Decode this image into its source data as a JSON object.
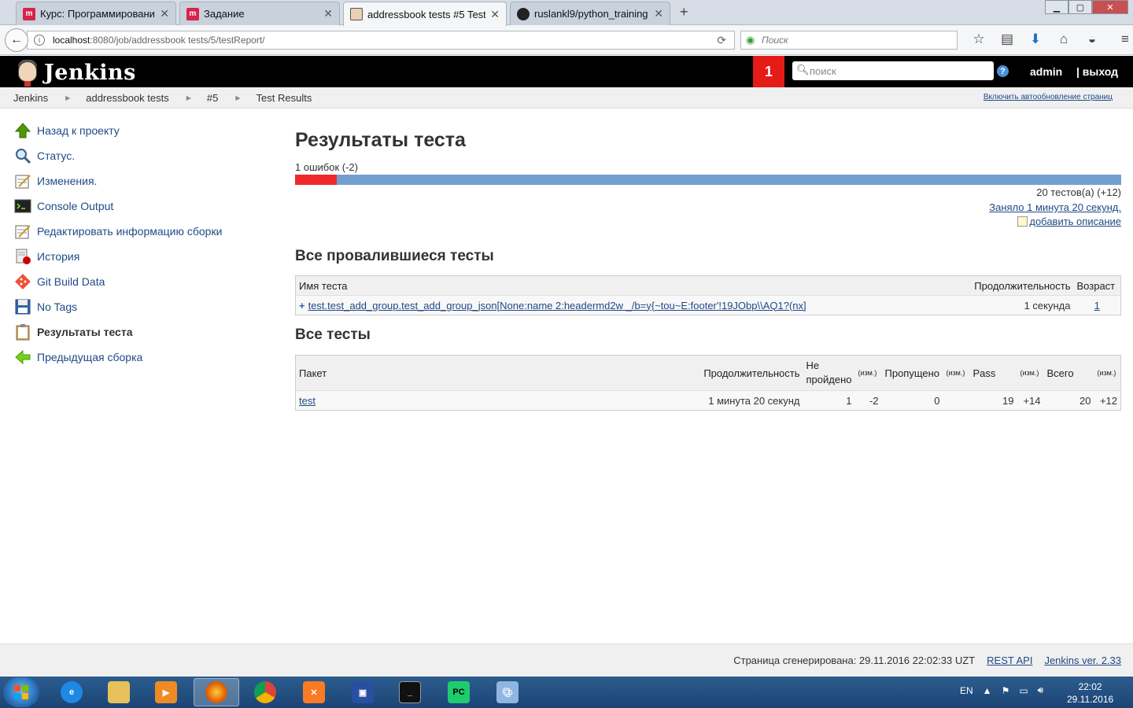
{
  "browser": {
    "tabs": [
      {
        "title": "Курс: Программировани...",
        "icon": "m-icon",
        "active": false
      },
      {
        "title": "Задание",
        "icon": "m-icon",
        "active": false
      },
      {
        "title": "addressbook tests #5 Test ...",
        "icon": "jenkins-icon",
        "active": true
      },
      {
        "title": "ruslankl9/python_training",
        "icon": "github-icon",
        "active": false
      }
    ],
    "url_host": "localhost",
    "url_path": ":8080/job/addressbook tests/5/testReport/",
    "search_placeholder": "Поиск"
  },
  "header": {
    "logo_text": "Jenkins",
    "badge_count": "1",
    "search_placeholder": "поиск",
    "help": "?",
    "user": "admin",
    "logout": "| выход"
  },
  "breadcrumb": {
    "items": [
      "Jenkins",
      "addressbook tests",
      "#5",
      "Test Results"
    ],
    "autorefresh": "Включить автообновление страниц"
  },
  "sidebar": {
    "items": [
      {
        "label": "Назад к проекту",
        "icon": "up-arrow-icon"
      },
      {
        "label": "Статус.",
        "icon": "magnifier-icon"
      },
      {
        "label": "Изменения.",
        "icon": "notepad-icon"
      },
      {
        "label": "Console Output",
        "icon": "terminal-icon"
      },
      {
        "label": "Редактировать информацию сборки",
        "icon": "notepad-icon"
      },
      {
        "label": "История",
        "icon": "history-icon"
      },
      {
        "label": "Git Build Data",
        "icon": "git-icon"
      },
      {
        "label": "No Tags",
        "icon": "floppy-icon"
      },
      {
        "label": "Результаты теста",
        "icon": "clipboard-icon"
      },
      {
        "label": "Предыдущая сборка",
        "icon": "left-arrow-icon"
      }
    ]
  },
  "main": {
    "title": "Результаты теста",
    "fail_summary": "1 ошибок (-2)",
    "fail_fraction": 0.05,
    "total_tests": "20 тестов(а) (+12)",
    "duration_link": "Заняло 1 минута 20 секунд.",
    "add_description": "добавить описание",
    "failed_section": {
      "heading": "Все провалившиеся тесты",
      "columns": [
        "Имя теста",
        "Продолжительность",
        "Возраст"
      ],
      "rows": [
        {
          "name": "test.test_add_group.test_add_group_json[None:name 2:headermd2w _/b=y{~tou~E:footer'!19JObp\\\\AQ1?(nx]",
          "duration": "1 секунда",
          "age": "1"
        }
      ]
    },
    "all_section": {
      "heading": "Все тесты",
      "columns": {
        "package": "Пакет",
        "duration": "Продолжительность",
        "failed": "Не пройдено",
        "diff": "(изм.)",
        "skipped": "Пропущено",
        "pass": "Pass",
        "total": "Всего"
      },
      "rows": [
        {
          "package": "test",
          "duration": "1 минута 20 секунд",
          "failed": "1",
          "failed_diff": "-2",
          "skipped": "0",
          "skipped_diff": "",
          "pass": "19",
          "pass_diff": "+14",
          "total": "20",
          "total_diff": "+12"
        }
      ]
    }
  },
  "footer": {
    "generated": "Страница сгенерирована: 29.11.2016 22:02:33 UZT",
    "rest_api": "REST API",
    "version": "Jenkins ver. 2.33"
  },
  "taskbar": {
    "lang": "EN",
    "time": "22:02",
    "date": "29.11.2016"
  },
  "colors": {
    "jenkins_header": "#000000",
    "badge_red": "#e41b17",
    "fail_red": "#ef2929",
    "pass_blue": "#729fcf",
    "link_blue": "#204a87"
  }
}
